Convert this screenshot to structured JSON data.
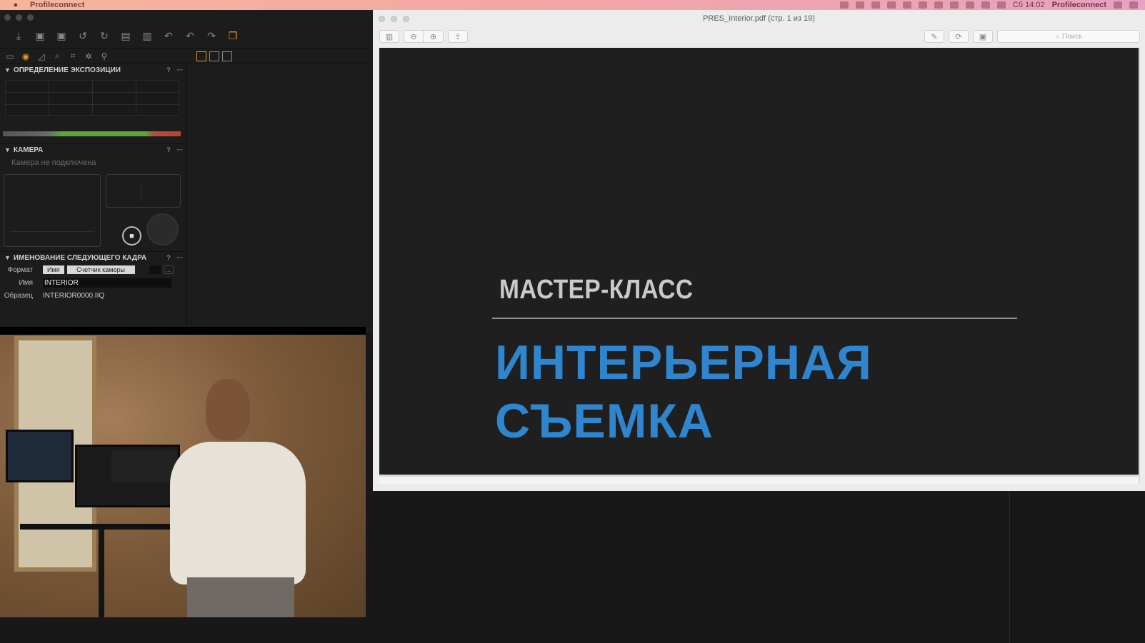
{
  "menubar": {
    "app_name": "Profileconnect",
    "clock": "Сб 14:02",
    "user": "Profileconnect"
  },
  "capture_one": {
    "exposure_panel": {
      "title": "ОПРЕДЕЛЕНИЕ ЭКСПОЗИЦИИ",
      "help": "?",
      "more": "···"
    },
    "camera_panel": {
      "title": "КАМЕРА",
      "help": "?",
      "more": "···",
      "status": "Камера не подключена"
    },
    "naming_panel": {
      "title": "ИМЕНОВАНИЕ СЛЕДУЮЩЕГО КАДРА",
      "help": "?",
      "more": "···",
      "format_label": "Формат",
      "format_tokens": [
        "Имя",
        "Счетчик камеры"
      ],
      "format_more": "...",
      "name_label": "Имя",
      "name_value": "INTERIOR",
      "sample_label": "Образец",
      "sample_value": "INTERIOR0000.IIQ"
    }
  },
  "preview": {
    "document_title": "PRES_Interior.pdf (стр. 1 из 19)",
    "search_placeholder": "Поиск",
    "slide": {
      "subtitle": "МАСТЕР-КЛАСС",
      "title_line1": "ИНТЕРЬЕРНАЯ",
      "title_line2": "СЪЕМКА"
    }
  },
  "colors": {
    "accent": "#e89b2a",
    "slide_title": "#2f86cf",
    "slide_bg": "#1f1f1f"
  }
}
